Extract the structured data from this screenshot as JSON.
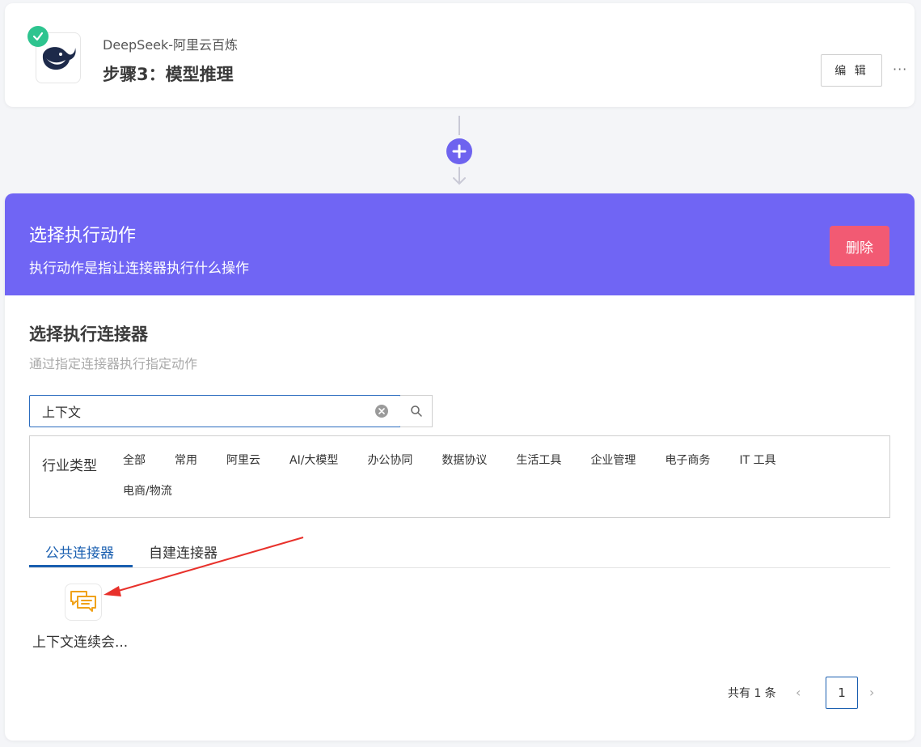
{
  "step": {
    "app_name": "DeepSeek-阿里云百炼",
    "title": "步骤3：模型推理",
    "edit_label": "编 辑",
    "more_label": "···",
    "status_icon": "check-icon",
    "status_color": "#2ec48f"
  },
  "connector": {
    "add_icon": "plus-icon",
    "accent_color": "#6e63ef"
  },
  "action": {
    "title": "选择执行动作",
    "subtitle": "执行动作是指让连接器执行什么操作",
    "delete_label": "删除",
    "header_color": "#7065f4",
    "delete_color": "#f25a73"
  },
  "connector_select": {
    "title": "选择执行连接器",
    "subtitle": "通过指定连接器执行指定动作",
    "search_value": "上下文",
    "industry_label": "行业类型",
    "industries": [
      "全部",
      "常用",
      "阿里云",
      "AI/大模型",
      "办公协同",
      "数据协议",
      "生活工具",
      "企业管理",
      "电子商务",
      "IT 工具",
      "电商/物流"
    ],
    "tabs": [
      {
        "label": "公共连接器",
        "active": true
      },
      {
        "label": "自建连接器",
        "active": false
      }
    ],
    "results": [
      {
        "name": "上下文连续会...",
        "icon": "chat-bubbles-icon"
      }
    ]
  },
  "pagination": {
    "total_text": "共有 1 条",
    "current_page": "1",
    "prev_label": "‹",
    "next_label": "›"
  }
}
